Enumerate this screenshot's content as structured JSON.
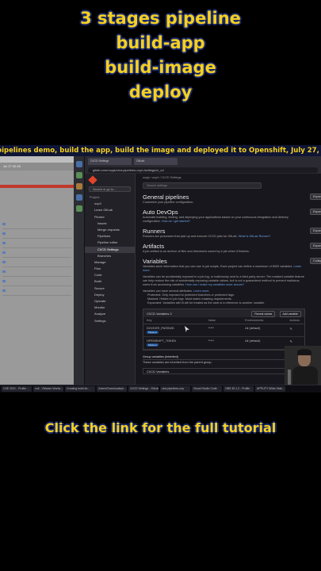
{
  "overlay": {
    "title_lines": [
      "3 stages pipeline",
      "build-app",
      "build-image",
      "deploy"
    ],
    "cta": "Click the link for the full tutorial"
  },
  "marquee": "pipelines demo, build the app, build the image and deployed it to Openshift, July 27, 2024.",
  "left_app": {
    "date": "Jul 27 00:45"
  },
  "browser": {
    "tabs": [
      "CI/CD Settings",
      "GitLab"
    ],
    "url": "gitlab.com/ocpjs/cicd-pipelines-ocp/-/settings/ci_cd"
  },
  "sidebar": {
    "search": "Search or go to...",
    "project_head": "Project",
    "items": [
      "ocp4",
      "Learn GitLab",
      "Pinned",
      "Issues",
      "Merge requests",
      "Pipelines",
      "Pipeline editor",
      "CI/CD Settings",
      "Branches",
      "Manage",
      "Plan",
      "Code",
      "Build",
      "Secure",
      "Deploy",
      "Operate",
      "Monitor",
      "Analyze",
      "Settings"
    ]
  },
  "main": {
    "breadcrumb": "ocpjs / ocp4 / CI/CD Settings",
    "search_placeholder": "Search settings",
    "sections": [
      {
        "title": "General pipelines",
        "desc": "Customize your pipeline configuration.",
        "button": "Expand"
      },
      {
        "title": "Auto DevOps",
        "desc": "Automate building, testing, and deploying your applications based on your continuous integration and delivery configuration.",
        "link": "How do I get started?",
        "button": "Expand"
      },
      {
        "title": "Runners",
        "desc": "Runners are processes that pick up and execute CI/CD jobs for GitLab.",
        "link": "What is GitLab Runner?",
        "button": "Expand"
      },
      {
        "title": "Artifacts",
        "desc": "A job artifact is an archive of files and directories saved by a job when it finishes.",
        "button": "Expand"
      },
      {
        "title": "Variables",
        "desc": "Variables store information that you can use in job scripts. Each project can define a maximum of 8000 variables.",
        "link": "Learn more.",
        "button": "Collapse"
      }
    ],
    "variables_text": "Variables can be accidentally exposed in a job log, or maliciously sent to a third party server. The masked variable feature can help reduce the risk of accidentally exposing variable values, but is not a guaranteed method to prevent malicious users from accessing variables.",
    "variables_link": "How can I make my variables more secure?",
    "variables_options_head": "Variables can have several attributes.",
    "variables_options_link": "Learn more.",
    "bullets": [
      "Protected: Only exposed to protected branches or protected tags.",
      "Masked: Hidden in job logs. Must match masking requirements.",
      "Expanded: Variables with $ will be treated as the start of a reference to another variable."
    ],
    "cicd_vars": {
      "title": "CI/CD Variables",
      "count": "2",
      "reveal_button": "Reveal values",
      "add_button": "Add variable",
      "columns": [
        "Key",
        "Value",
        "Environments",
        "Actions"
      ],
      "rows": [
        {
          "key": "DOCKER_PASSWD",
          "badge": "Masked",
          "value": "*****",
          "env": "All (default)"
        },
        {
          "key": "OPENSHIFT_TOKEN",
          "badge": "Masked",
          "value": "*****",
          "env": "All (default)"
        }
      ]
    },
    "group_vars": {
      "title": "Group variables (inherited)",
      "text": "These variables are inherited from the parent group."
    },
    "cicd2": "CI/CD Variables"
  },
  "taskbar": [
    "CSE 2021 - Profile ...",
    "ocit - VMware Works...",
    "Creating build for...",
    "/Users/Downloads/pi...",
    "CI/CD Settings - GitLab",
    "cicd-pipelines-ocp",
    "Visual Studio Code",
    "OBS 30.1.2 - Profile",
    "APPLITY Whim Mak..."
  ],
  "colors": {
    "overlay_text": "#f5d020",
    "overlay_outline": "#1b2a6b",
    "gitlab_bg": "#18171d",
    "link": "#6aa2e8",
    "badge": "#1b4d8a"
  }
}
